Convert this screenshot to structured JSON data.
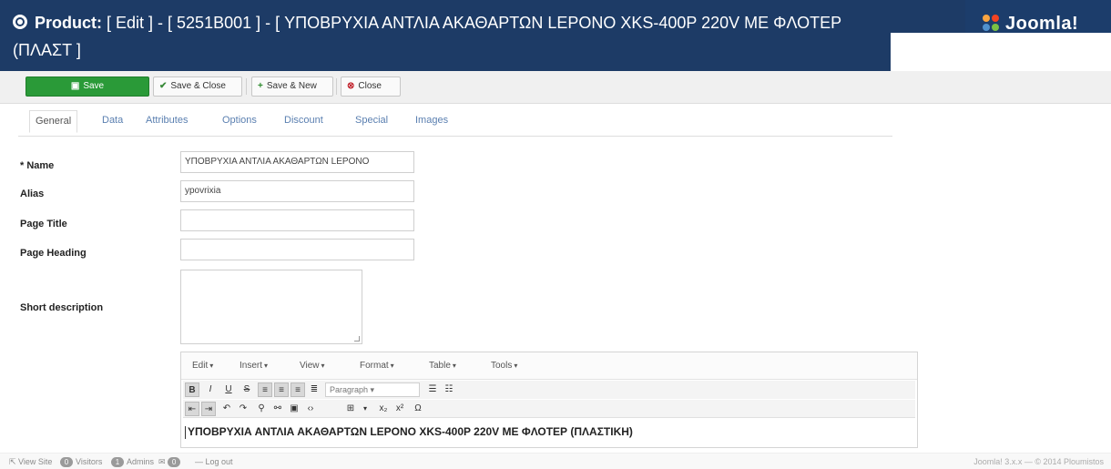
{
  "header": {
    "title_prefix": "Product:",
    "title_rest": "[ Edit ] - [ 5251B001 ] - [ ΥΠΟΒΡΥΧΙΑ ΑΝΤΛΙΑ ΑΚΑΘΑΡΤΩΝ LEPONO XKS-400P 220V ΜΕ ΦΛΟΤΕΡ",
    "title_line2": "(ΠΛΑΣΤ ]",
    "brand": "Joomla!",
    "colors": {
      "header_bg": "#1d3b66",
      "save_green": "#2a9a38"
    }
  },
  "toolbar": {
    "save_label": "Save",
    "save_close_label": "Save & Close",
    "save_new_label": "Save & New",
    "close_label": "Close"
  },
  "tabs": [
    {
      "label": "General",
      "active": true
    },
    {
      "label": "Data"
    },
    {
      "label": "Attributes"
    },
    {
      "label": "Options"
    },
    {
      "label": "Discount"
    },
    {
      "label": "Special"
    },
    {
      "label": "Images"
    }
  ],
  "form": {
    "name_label": "* Name",
    "name_value": "ΥΠΟΒΡΥΧΙΑ ΑΝΤΛΙΑ ΑΚΑΘΑΡΤΩΝ LEPONO",
    "alias_label": "Alias",
    "alias_value": "ypovrixia",
    "page_title_label": "Page Title",
    "page_title_value": "",
    "page_heading_label": "Page Heading",
    "page_heading_value": "",
    "short_description_label": "Short description"
  },
  "editor": {
    "menus": [
      "Edit",
      "Insert",
      "View",
      "Format",
      "Table",
      "Tools"
    ],
    "paragraph_label": "Paragraph",
    "content": "ΥΠΟΒΡΥΧΙΑ ΑΝΤΛΙΑ ΑΚΑΘΑΡΤΩΝ LEPONO XKS-400P 220V ΜΕ ΦΛΟΤΕΡ (ΠΛΑΣΤΙΚΗ)"
  },
  "footer": {
    "view_site": "View Site",
    "visitors_count": "0",
    "visitors_label": "Visitors",
    "admins_count": "1",
    "admins_label": "Admins",
    "messages_count": "0",
    "logout": "Log out",
    "right_text": "Joomla! 3.x.x — © 2014 Ploumistos"
  }
}
